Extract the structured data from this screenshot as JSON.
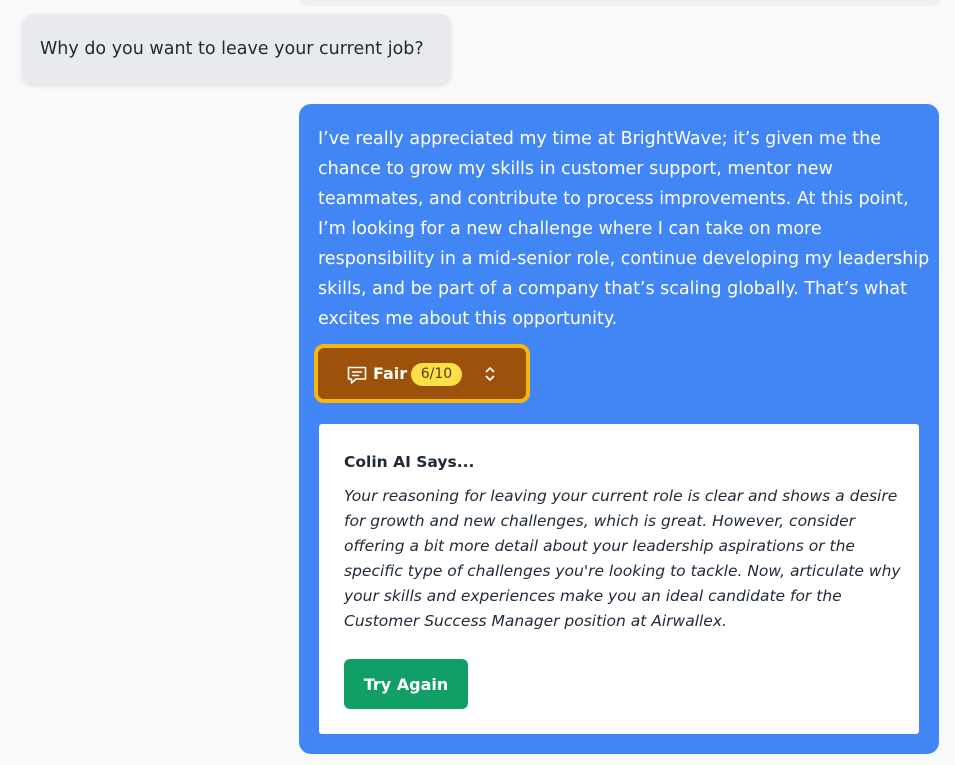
{
  "question": {
    "text": "Why do you want to leave your current job?"
  },
  "answer": {
    "text": "I’ve really appreciated my time at BrightWave; it’s given me the chance to grow my skills in customer support, mentor new teammates, and contribute to process improvements. At this point, I’m looking for a new challenge where I can take on more responsibility in a mid-senior role, continue developing my leadership skills, and be part of a company that’s scaling globally. That’s what excites me about this opportunity."
  },
  "score": {
    "icon": "chat-bubble-icon",
    "label": "Fair",
    "value": "6/10",
    "expand_icon": "chevron-up-down-icon"
  },
  "feedback": {
    "title": "Colin AI Says...",
    "body": "Your reasoning for leaving your current role is clear and shows a desire for growth and new challenges, which is great. However, consider offering a bit more detail about your leadership aspirations or the specific type of challenges you're looking to tackle. Now, articulate why your skills and experiences make you an ideal candidate for the Customer Success Manager position at Airwallex.",
    "button_label": "Try Again"
  },
  "colors": {
    "answer_bubble": "#4285f4",
    "score_chip": "#9c520a",
    "score_border": "#f5b80a",
    "score_badge": "#fde047",
    "try_again_button": "#129e67"
  }
}
